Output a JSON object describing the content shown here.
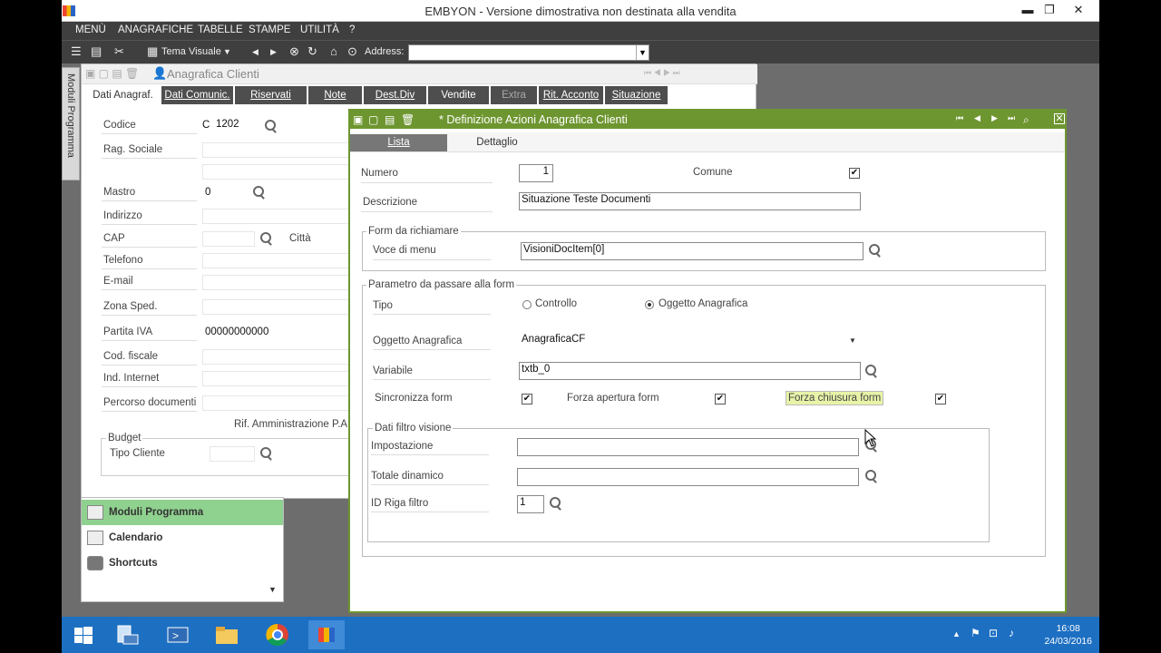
{
  "window": {
    "title": "EMBYON - Versione dimostrativa non destinata alla vendita",
    "minimize": "▬",
    "restore": "❐",
    "close": "✕"
  },
  "menubar": [
    "MENÙ",
    "ANAGRAFICHE",
    "TABELLE",
    "STAMPE",
    "UTILITÀ",
    "?"
  ],
  "toolbar": {
    "theme_label": "Tema Visuale",
    "address_label": "Address:",
    "address_value": ""
  },
  "sidetab": {
    "label": "Moduli Programma"
  },
  "bg_window": {
    "title": "Anagrafica Clienti",
    "tabs": [
      "Dati Anagraf.",
      "Dati Comunic.",
      "Riservati",
      "Note",
      "Dest.Div",
      "Vendite",
      "Extra",
      "Rit. Acconto",
      "Situazione"
    ],
    "fields": {
      "codice_label": "Codice",
      "codice_prefix": "C",
      "codice_value": "1202",
      "rag_sociale_label": "Rag. Sociale",
      "mastro_label": "Mastro",
      "mastro_value": "0",
      "indirizzo_label": "Indirizzo",
      "cap_label": "CAP",
      "citta_label": "Città",
      "telefono_label": "Telefono",
      "email_label": "E-mail",
      "zona_label": "Zona Sped.",
      "piva_label": "Partita IVA",
      "piva_value": "00000000000",
      "codfisc_label": "Cod. fiscale",
      "internet_label": "Ind. Internet",
      "percorso_label": "Percorso documenti",
      "rif_label": "Rif. Amministrazione P.A.",
      "budget_label": "Budget",
      "tipo_cliente_label": "Tipo Cliente"
    }
  },
  "modules_panel": {
    "items": [
      "Moduli Programma",
      "Calendario",
      "Shortcuts"
    ],
    "active_color": "#8fd18f"
  },
  "dialog": {
    "title": "* Definizione Azioni Anagrafica Clienti",
    "tabs": [
      "Lista",
      "Dettaglio"
    ],
    "numero_label": "Numero",
    "numero_value": "1",
    "comune_label": "Comune",
    "descrizione_label": "Descrizione",
    "descrizione_value": "Situazione Teste Documenti",
    "form_group_title": "Form da richiamare",
    "voce_menu_label": "Voce di menu",
    "voce_menu_value": "VisioniDocItem[0]",
    "param_group_title": "Parametro da passare alla form",
    "tipo_label": "Tipo",
    "radio_controllo": "Controllo",
    "radio_oggetto": "Oggetto Anagrafica",
    "oggetto_label": "Oggetto Anagrafica",
    "oggetto_value": "AnagraficaCF",
    "variabile_label": "Variabile",
    "variabile_value": "txtb_0",
    "sincronizza_label": "Sincronizza form",
    "forza_apertura_label": "Forza apertura form",
    "forza_chiusura_label": "Forza chiusura form",
    "filtro_group_title": "Dati filtro visione",
    "impostazione_label": "Impostazione",
    "impostazione_value": "",
    "totale_label": "Totale dinamico",
    "totale_value": "",
    "id_riga_label": "ID Riga filtro",
    "id_riga_value": "1"
  },
  "taskbar": {
    "time": "16:08",
    "date": "24/03/2016",
    "color": "#1d6fc2"
  },
  "colors": {
    "dialog_accent": "#6e9630",
    "tab_dark": "#4e4e4e",
    "highlight": "#e8f3a8"
  }
}
